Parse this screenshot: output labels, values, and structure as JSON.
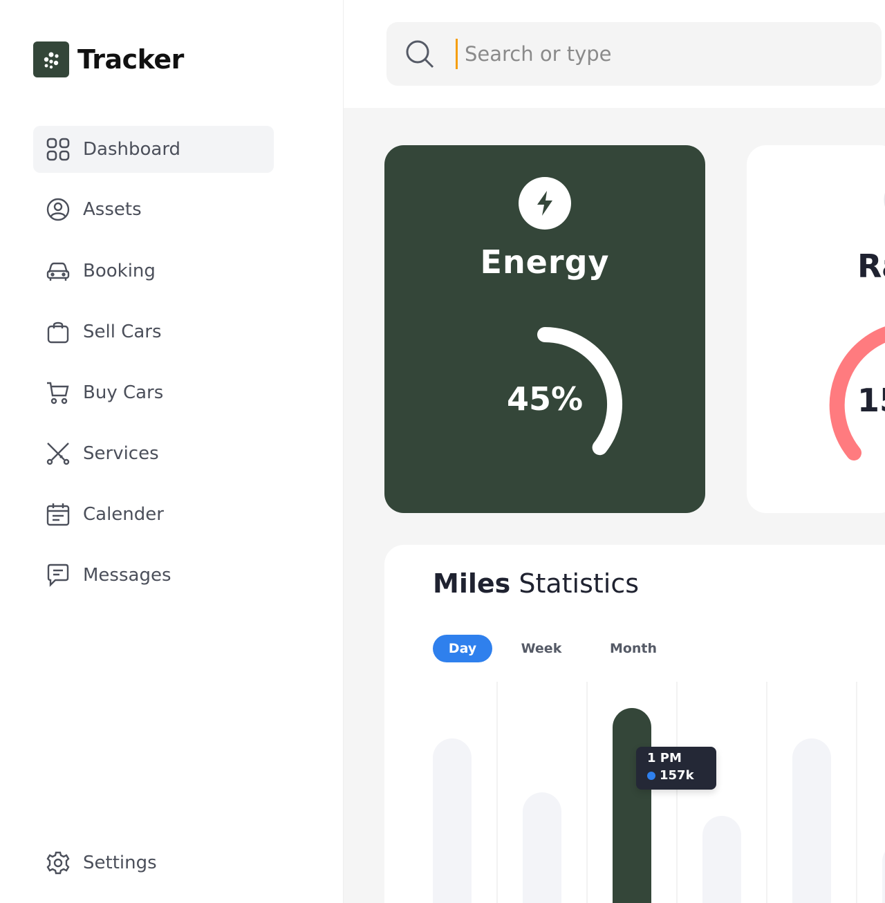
{
  "brand": {
    "name": "Tracker"
  },
  "search": {
    "placeholder": "Search or type"
  },
  "sidebar": {
    "items": [
      {
        "label": "Dashboard",
        "icon": "grid-icon",
        "active": true
      },
      {
        "label": "Assets",
        "icon": "steering-wheel-icon"
      },
      {
        "label": "Booking",
        "icon": "car-icon"
      },
      {
        "label": "Sell Cars",
        "icon": "shopping-bag-icon"
      },
      {
        "label": "Buy Cars",
        "icon": "cart-icon"
      },
      {
        "label": "Services",
        "icon": "tools-icon"
      },
      {
        "label": "Calender",
        "icon": "calendar-icon"
      },
      {
        "label": "Messages",
        "icon": "message-icon"
      }
    ],
    "settings": {
      "label": "Settings",
      "icon": "gear-icon"
    }
  },
  "cards": {
    "energy": {
      "title": "Energy",
      "value": "45%",
      "percent": 45,
      "icon": "bolt-icon"
    },
    "range": {
      "title": "Ra",
      "value": "15"
    }
  },
  "stats": {
    "title_bold": "Miles",
    "title_rest": " Statistics",
    "tabs": [
      "Day",
      "Week",
      "Month"
    ],
    "active_tab": "Day",
    "tooltip": {
      "time": "1 PM",
      "value": "157k"
    }
  },
  "colors": {
    "brand": "#344639",
    "accent": "#2f80ed",
    "range": "#ff7b7f",
    "caret": "#f59e0b"
  },
  "chart_data": {
    "type": "bar",
    "categories": [
      "",
      "",
      "1 PM",
      "",
      "",
      ""
    ],
    "values": [
      250,
      172,
      294,
      138,
      250,
      100
    ],
    "highlight_index": 2,
    "ylim": [
      0,
      300
    ]
  }
}
